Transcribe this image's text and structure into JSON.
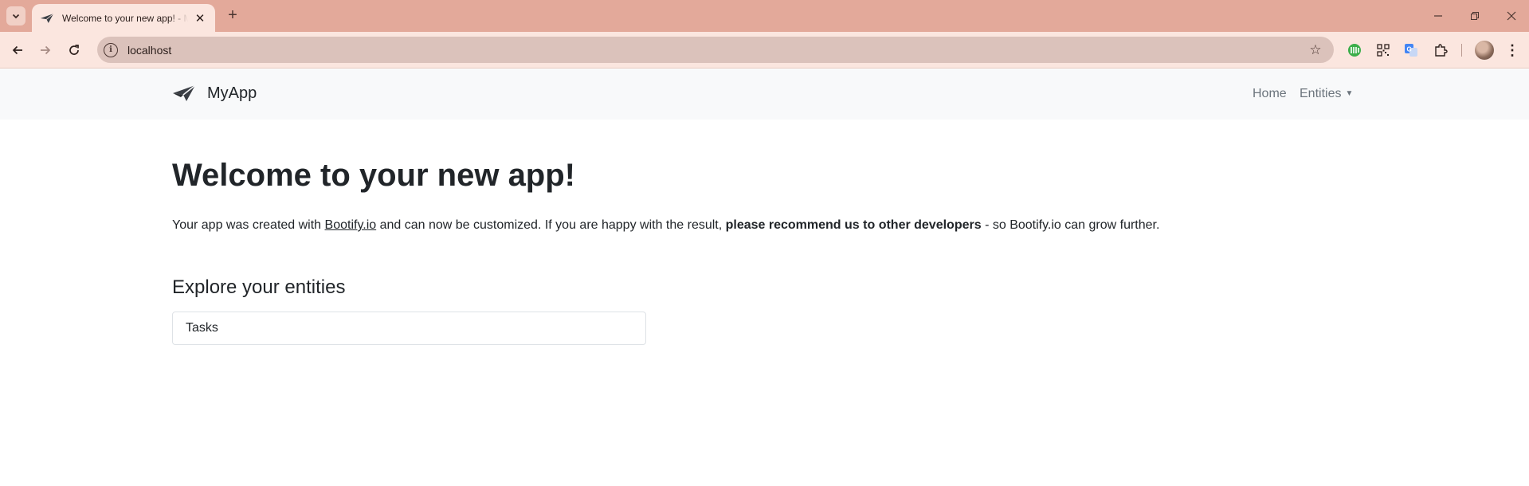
{
  "browser": {
    "tab": {
      "title": "Welcome to your new app! - MyApp",
      "favicon": "paper-plane-icon"
    },
    "url": "localhost",
    "colors": {
      "tabstrip": "#e3a99a",
      "toolbar": "#fbe6df",
      "omnibox": "#dbc2bb"
    }
  },
  "navbar": {
    "brand": "MyApp",
    "links": {
      "home": "Home",
      "entities": "Entities"
    }
  },
  "main": {
    "title": "Welcome to your new app!",
    "intro": {
      "prefix": "Your app was created with ",
      "link": "Bootify.io",
      "middle": " and can now be customized. If you are happy with the result, ",
      "bold": "please recommend us to other developers",
      "suffix": " - so Bootify.io can grow further."
    },
    "section_title": "Explore your entities",
    "entities": [
      "Tasks"
    ]
  }
}
